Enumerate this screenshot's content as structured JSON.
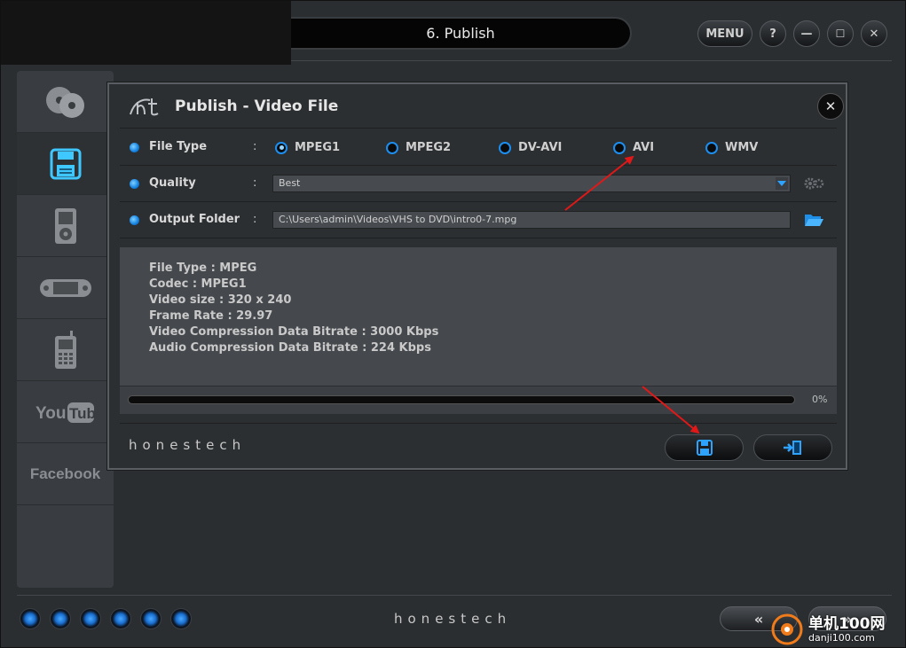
{
  "window": {
    "title": "6. Publish",
    "buttons": {
      "menu": "MENU",
      "help": "?",
      "minimize": "—",
      "maximize": "☐",
      "close": "✕"
    }
  },
  "sidebar": {
    "items": [
      {
        "name": "disc",
        "label": ""
      },
      {
        "name": "video-file",
        "label": ""
      },
      {
        "name": "ipod",
        "label": ""
      },
      {
        "name": "psp",
        "label": ""
      },
      {
        "name": "mobile",
        "label": ""
      },
      {
        "name": "youtube",
        "label": "YouTube"
      },
      {
        "name": "facebook",
        "label": "Facebook"
      }
    ],
    "active": "video-file"
  },
  "dialog": {
    "logo": "ht",
    "title": "Publish - Video File",
    "close": "✕",
    "file_type": {
      "label": "File Type",
      "colon": ":",
      "options": [
        "MPEG1",
        "MPEG2",
        "DV-AVI",
        "AVI",
        "WMV"
      ],
      "selected": "MPEG1"
    },
    "quality": {
      "label": "Quality",
      "colon": ":",
      "value": "Best"
    },
    "output_folder": {
      "label": "Output Folder",
      "colon": ":",
      "value": "C:\\Users\\admin\\Videos\\VHS to DVD\\intro0-7.mpg"
    },
    "info": [
      "File Type : MPEG",
      "Codec : MPEG1",
      "Video size : 320 x 240",
      "Frame Rate : 29.97",
      "Video Compression Data Bitrate : 3000 Kbps",
      "Audio Compression Data Bitrate : 224 Kbps"
    ],
    "progress": {
      "value": 0,
      "text": "0%"
    },
    "brand": "honestech"
  },
  "footer": {
    "brand": "honestech",
    "back": "«",
    "next": "»"
  },
  "watermark": {
    "title": "单机100网",
    "url": "danji100.com"
  },
  "colors": {
    "accent": "#1c8ef0",
    "annotation": "#e01818"
  }
}
